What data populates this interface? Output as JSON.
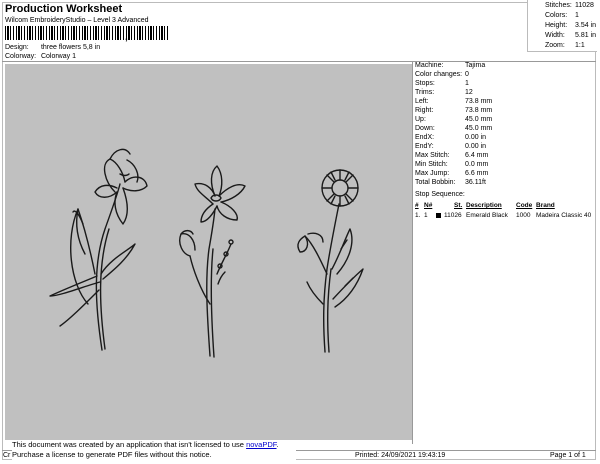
{
  "header": {
    "title": "Production Worksheet",
    "subtitle": "Wilcom EmbroideryStudio – Level 3 Advanced",
    "barcode_tail": ","
  },
  "info": {
    "design_label": "Design:",
    "design_value": "three flowers 5,8 in",
    "colorway_label": "Colorway:",
    "colorway_value": "Colorway 1"
  },
  "stats": [
    {
      "label": "Stitches:",
      "value": "11028"
    },
    {
      "label": "Colors:",
      "value": "1"
    },
    {
      "label": "Height:",
      "value": "3.54 in"
    },
    {
      "label": "Width:",
      "value": "5.81 in"
    },
    {
      "label": "Zoom:",
      "value": "1:1"
    }
  ],
  "machine": [
    {
      "label": "Machine:",
      "value": "Tajima"
    },
    {
      "label": "Color changes:",
      "value": "0"
    },
    {
      "label": "Stops:",
      "value": "1"
    },
    {
      "label": "Trims:",
      "value": "12"
    },
    {
      "label": "Left:",
      "value": "73.8 mm"
    },
    {
      "label": "Right:",
      "value": "73.8 mm"
    },
    {
      "label": "Up:",
      "value": "45.0 mm"
    },
    {
      "label": "Down:",
      "value": "45.0 mm"
    },
    {
      "label": "EndX:",
      "value": "0.00 in"
    },
    {
      "label": "EndY:",
      "value": "0.00 in"
    },
    {
      "label": "Max Stitch:",
      "value": "6.4 mm"
    },
    {
      "label": "Min Stitch:",
      "value": "0.0 mm"
    },
    {
      "label": "Max Jump:",
      "value": "6.6 mm"
    },
    {
      "label": "Total Bobbin:",
      "value": "36.11ft"
    }
  ],
  "stop_sequence": {
    "heading": "Stop Sequence:",
    "columns": [
      "#",
      "N#",
      "St.",
      "Description",
      "Code",
      "Brand"
    ],
    "rows": [
      {
        "num": "1.",
        "n": "1",
        "st": "11026",
        "description": "Emerald Black",
        "code": "1000",
        "brand": "Madeira Classic 40",
        "color": "#000000"
      }
    ]
  },
  "notice": {
    "line1_prefix": "This document was created by an application that isn't licensed to use ",
    "link": "novaPDF",
    "line1_suffix": ".",
    "line2": "Purchase a license to generate PDF files without this notice.",
    "cr": "Cr"
  },
  "footer": {
    "printed": "Printed: 24/09/2021 19:43:19",
    "page": "Page 1 of 1"
  },
  "colors": {
    "canvas": "#c0c0c0",
    "thread": "#1a1a1a",
    "link": "#0000cc"
  }
}
